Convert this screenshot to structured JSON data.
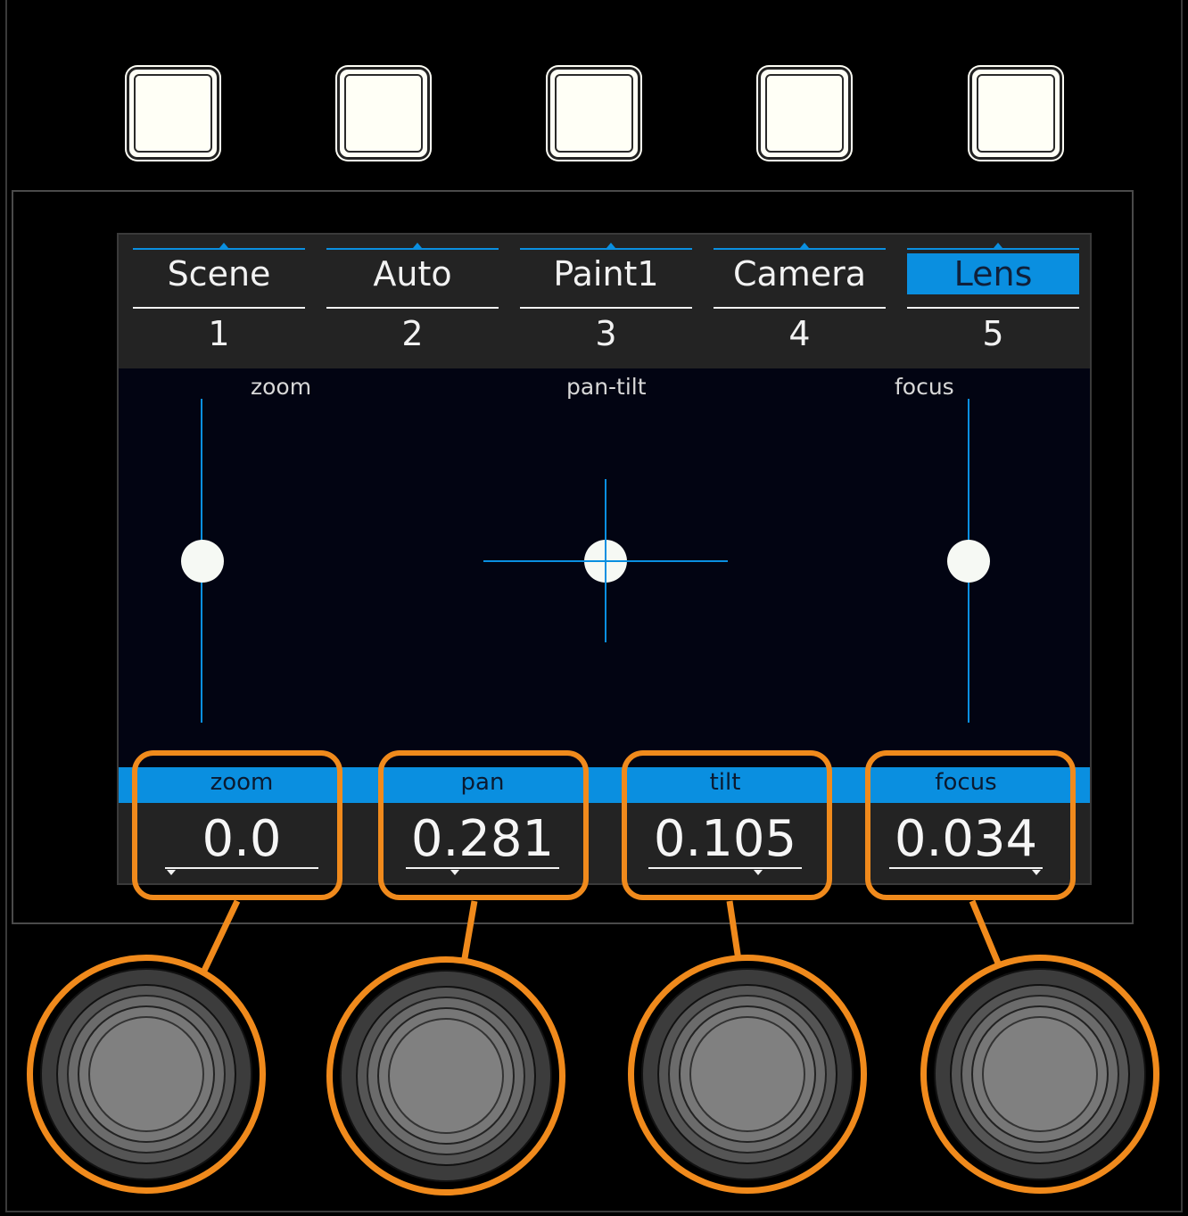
{
  "tabs": [
    {
      "name": "Scene",
      "number": "1",
      "active": false
    },
    {
      "name": "Auto",
      "number": "2",
      "active": false
    },
    {
      "name": "Paint1",
      "number": "3",
      "active": false
    },
    {
      "name": "Camera",
      "number": "4",
      "active": false
    },
    {
      "name": "Lens",
      "number": "5",
      "active": true
    }
  ],
  "controls": {
    "zoom_label": "zoom",
    "pantilt_label": "pan-tilt",
    "focus_label": "focus"
  },
  "params": [
    {
      "name": "zoom",
      "value": "0.0"
    },
    {
      "name": "pan",
      "value": "0.281"
    },
    {
      "name": "tilt",
      "value": "0.105"
    },
    {
      "name": "focus",
      "value": "0.034"
    }
  ],
  "colors": {
    "accent": "#0a8fe0",
    "callout": "#f08a1c",
    "screen_bg": "#020412",
    "bar_bg": "#232323"
  },
  "icons": {
    "hardware_key": "square-key",
    "encoder": "rotary-knob-icon"
  }
}
